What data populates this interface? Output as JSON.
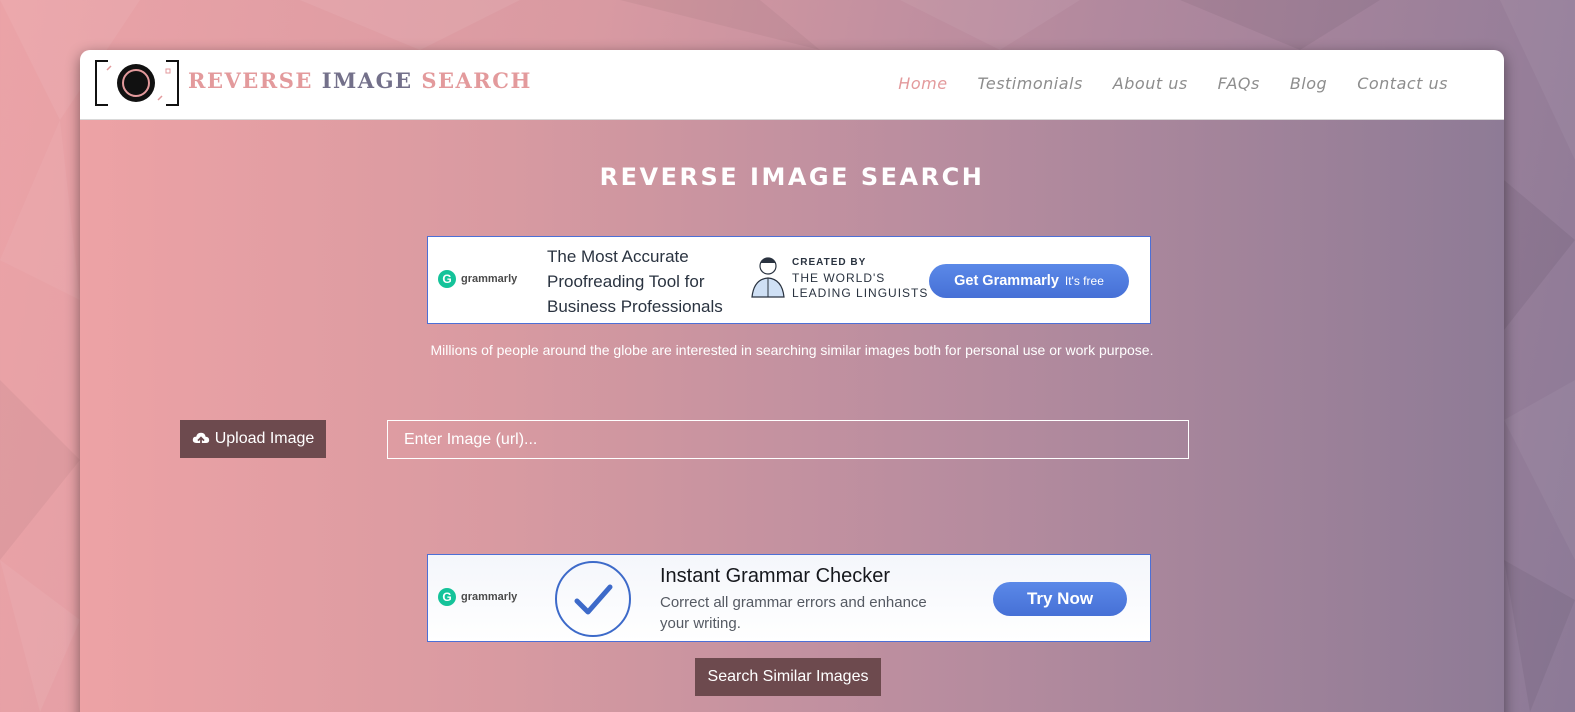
{
  "brand": {
    "logo_word_1": "REVERSE",
    "logo_word_2": "IMAGE",
    "logo_word_3": "SEARCH",
    "colors": {
      "pink": "#e39a9c",
      "slate": "#73708a",
      "button": "#6d4a4e",
      "ad_blue": "#4670d6"
    }
  },
  "nav": {
    "items": [
      {
        "label": "Home",
        "active": true
      },
      {
        "label": "Testimonials"
      },
      {
        "label": "About us"
      },
      {
        "label": "FAQs"
      },
      {
        "label": "Blog"
      },
      {
        "label": "Contact us"
      }
    ]
  },
  "main": {
    "title": "REVERSE IMAGE SEARCH",
    "tagline": "Millions of people around the globe are interested in searching similar images both for personal use or work purpose.",
    "upload_label": "Upload Image",
    "upload_icon": "cloud-upload-icon",
    "url_placeholder": "Enter Image (url)...",
    "search_label": "Search Similar Images"
  },
  "ad_top": {
    "brand": "grammarly",
    "brand_icon": "G",
    "headline": "The Most Accurate Proofreading Tool for Business Professionals",
    "credit_line1": "CREATED BY",
    "credit_line2": "THE WORLD'S LEADING LINGUISTS",
    "cta": "Get Grammarly",
    "cta_sub": "It's free"
  },
  "ad_bottom": {
    "brand": "grammarly",
    "brand_icon": "G",
    "title": "Instant Grammar Checker",
    "description": "Correct all grammar errors and enhance your writing.",
    "cta": "Try Now",
    "check_icon": "checkmark-icon"
  }
}
